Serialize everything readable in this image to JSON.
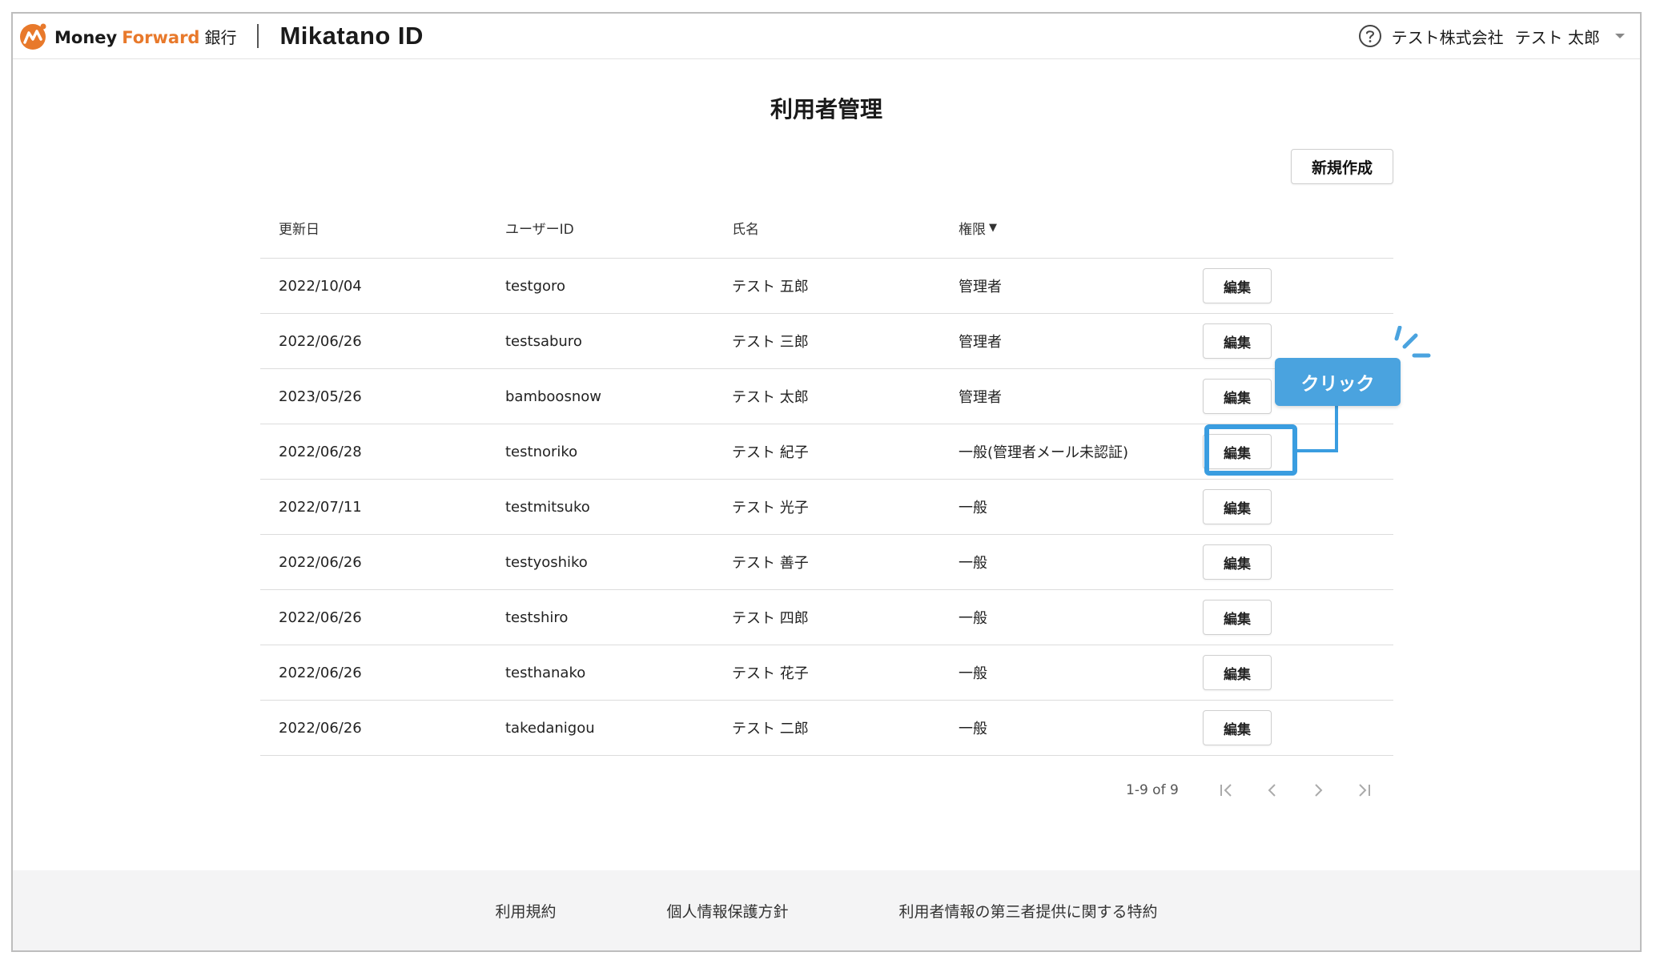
{
  "header": {
    "brand_money": "Money",
    "brand_forward": "Forward",
    "brand_bank": "銀行",
    "brand_product": "Mikatano ID",
    "company": "テスト株式会社",
    "username": "テスト 太郎",
    "help_icon": "help-circle-icon",
    "menu_icon": "caret-down-icon"
  },
  "page": {
    "title": "利用者管理",
    "new_button": "新規作成"
  },
  "table": {
    "headers": [
      "更新日",
      "ユーザーID",
      "氏名",
      "権限"
    ],
    "sort_indicator": "▼",
    "edit_label": "編集",
    "rows": [
      {
        "date": "2022/10/04",
        "user_id": "testgoro",
        "name": "テスト 五郎",
        "role": "管理者"
      },
      {
        "date": "2022/06/26",
        "user_id": "testsaburo",
        "name": "テスト 三郎",
        "role": "管理者"
      },
      {
        "date": "2023/05/26",
        "user_id": "bamboosnow",
        "name": "テスト 太郎",
        "role": "管理者"
      },
      {
        "date": "2022/06/28",
        "user_id": "testnoriko",
        "name": "テスト 紀子",
        "role": "一般(管理者メール未認証)"
      },
      {
        "date": "2022/07/11",
        "user_id": "testmitsuko",
        "name": "テスト 光子",
        "role": "一般"
      },
      {
        "date": "2022/06/26",
        "user_id": "testyoshiko",
        "name": "テスト 善子",
        "role": "一般"
      },
      {
        "date": "2022/06/26",
        "user_id": "testshiro",
        "name": "テスト 四郎",
        "role": "一般"
      },
      {
        "date": "2022/06/26",
        "user_id": "testhanako",
        "name": "テスト 花子",
        "role": "一般"
      },
      {
        "date": "2022/06/26",
        "user_id": "takedanigou",
        "name": "テスト 二郎",
        "role": "一般"
      }
    ]
  },
  "pagination": {
    "range": "1-9 of 9"
  },
  "callout": {
    "label": "クリック",
    "color": "#4aa3df"
  },
  "footer": {
    "links": [
      "利用規約",
      "個人情報保護方針",
      "利用者情報の第三者提供に関する特約"
    ]
  }
}
